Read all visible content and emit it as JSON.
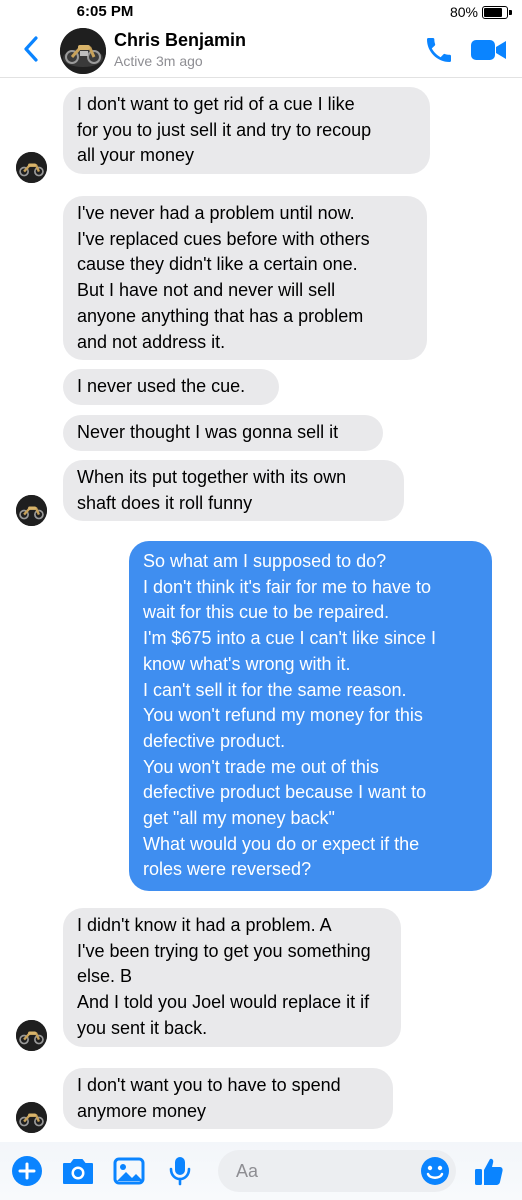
{
  "status_bar": {
    "time": "6:05 PM",
    "battery": "80%",
    "battery_level": 0.8
  },
  "header": {
    "contact_name": "Chris Benjamin",
    "active_status": "Active 3m ago",
    "icons": {
      "back": "chevron-left-icon",
      "call": "phone-icon",
      "video": "video-camera-icon"
    },
    "accent_color": "#0a84ff"
  },
  "messages": [
    {
      "sender": "contact",
      "text": "I don't want to get rid of a cue I like\nfor you to just sell it and try to recoup\nall your money"
    },
    {
      "sender": "contact",
      "text": "I've never had a problem until now.\nI've replaced cues before with others\ncause they didn't like a certain one.\nBut I have not and never will sell\nanyone anything that has a problem\nand not address it."
    },
    {
      "sender": "contact",
      "text": "I never used the cue."
    },
    {
      "sender": "contact",
      "text": "Never thought I was gonna sell it"
    },
    {
      "sender": "contact",
      "text": "When its put together with its own\nshaft does it roll funny"
    },
    {
      "sender": "me",
      "text": "So what am I supposed to do?\nI don't think it's fair for me to have to\nwait for this cue to be repaired.\nI'm $675 into a cue I can't like since I\nknow what's wrong with it.\nI can't sell it for the same reason.\nYou won't refund my money for this\ndefective product.\nYou won't trade me out of this\ndefective product because I want to\nget \"all my money back\"\nWhat would you do or expect if the\nroles were reversed?"
    },
    {
      "sender": "contact",
      "text": "I didn't know it had a problem. A\nI've been trying to get you something\nelse. B\nAnd I told you Joel would replace it if\nyou sent it back."
    },
    {
      "sender": "contact",
      "text": "I don't want you to have to spend\nanymore money"
    }
  ],
  "composer": {
    "placeholder": "Aa",
    "icons": [
      "plus-icon",
      "camera-icon",
      "photo-icon",
      "microphone-icon",
      "emoji-icon",
      "thumbs-up-icon"
    ]
  },
  "colors": {
    "incoming_bubble": "#e9e9eb",
    "outgoing_bubble": "#3f8ef0",
    "accent": "#0a84ff"
  }
}
